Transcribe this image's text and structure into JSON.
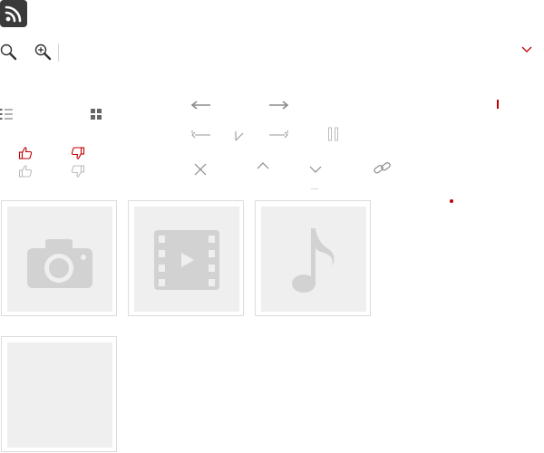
{
  "toolbar": {
    "icons": [
      "rss-icon",
      "search-icon",
      "zoom-in-icon",
      "chevron-down-icon"
    ]
  },
  "view_toggles": [
    "list-view-icon",
    "grid-view-icon"
  ],
  "feedback": [
    "thumbs-up-icon",
    "thumbs-down-icon"
  ],
  "navigation": [
    "arrow-left-icon",
    "arrow-right-icon",
    "first-icon",
    "last-icon",
    "pause-icon",
    "close-icon",
    "chevron-up-icon",
    "chevron-down-icon",
    "link-icon"
  ],
  "thumbnails": [
    {
      "type": "image",
      "icon": "camera-icon"
    },
    {
      "type": "video",
      "icon": "film-icon"
    },
    {
      "type": "audio",
      "icon": "music-note-icon"
    },
    {
      "type": "empty",
      "icon": ""
    }
  ],
  "colors": {
    "accent": "#c00000",
    "icon_gray": "#8a8a8a",
    "light_gray": "#bdbdbd",
    "placeholder_bg": "#efefef",
    "placeholder_icon": "#d2d2d2",
    "dark": "#333333"
  }
}
